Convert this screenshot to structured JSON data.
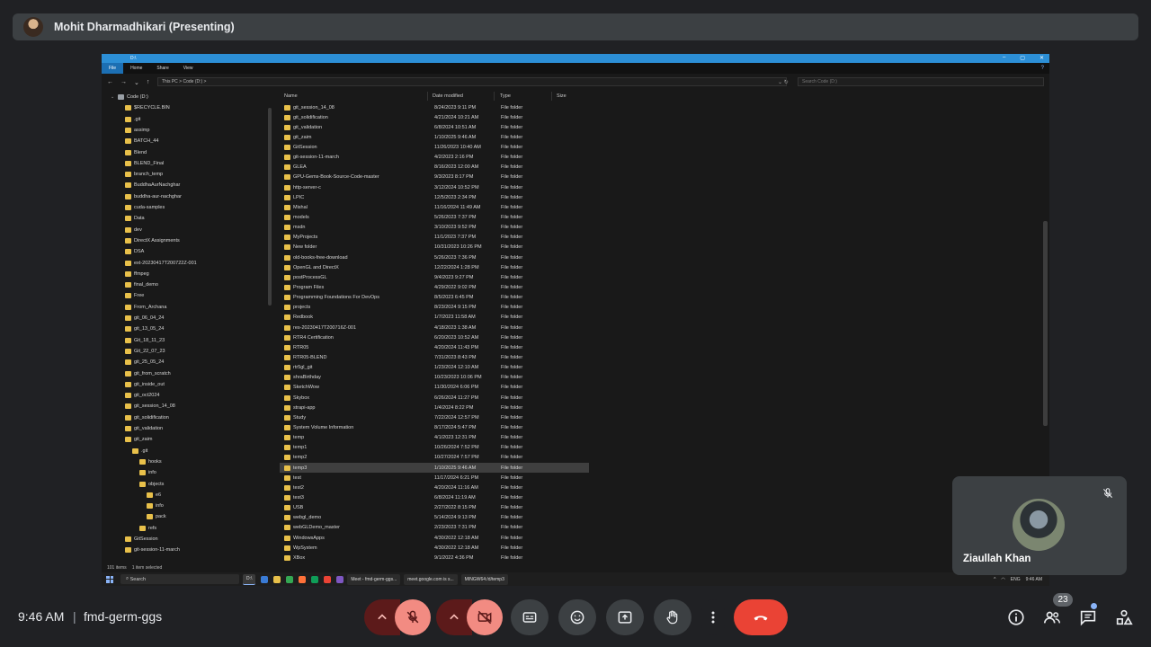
{
  "presenter": {
    "name": "Mohit Dharmadhikari (Presenting)"
  },
  "explorer": {
    "window_title": "D:\\",
    "ribbon_tabs": [
      "File",
      "Home",
      "Share",
      "View"
    ],
    "address": "This PC  >  Code (D:)  >",
    "search_placeholder": "Search Code (D:)",
    "columns": {
      "name": "Name",
      "date": "Date modified",
      "type": "Type",
      "size": "Size"
    },
    "nav_items": [
      {
        "label": "Code (D:)",
        "level": 0,
        "drive": true
      },
      {
        "label": "$RECYCLE.BIN",
        "level": 1
      },
      {
        "label": ".git",
        "level": 1
      },
      {
        "label": "assimp",
        "level": 1
      },
      {
        "label": "BATCH_44",
        "level": 1
      },
      {
        "label": "Blend",
        "level": 1
      },
      {
        "label": "BLEND_Final",
        "level": 1
      },
      {
        "label": "branch_temp",
        "level": 1
      },
      {
        "label": "BuddhaAurNachghar",
        "level": 1
      },
      {
        "label": "buddha-aur-nachghar",
        "level": 1
      },
      {
        "label": "cuda-samples",
        "level": 1
      },
      {
        "label": "Data",
        "level": 1
      },
      {
        "label": "dev",
        "level": 1
      },
      {
        "label": "DirectX Assignments",
        "level": 1
      },
      {
        "label": "DSA",
        "level": 1
      },
      {
        "label": "ext-20230417T200722Z-001",
        "level": 1
      },
      {
        "label": "ffmpeg",
        "level": 1
      },
      {
        "label": "final_demo",
        "level": 1
      },
      {
        "label": "Free",
        "level": 1
      },
      {
        "label": "From_Archana",
        "level": 1
      },
      {
        "label": "git_06_04_24",
        "level": 1
      },
      {
        "label": "git_13_05_24",
        "level": 1
      },
      {
        "label": "Git_18_11_23",
        "level": 1
      },
      {
        "label": "Git_22_07_23",
        "level": 1
      },
      {
        "label": "git_25_05_24",
        "level": 1
      },
      {
        "label": "git_from_scratch",
        "level": 1
      },
      {
        "label": "git_inside_out",
        "level": 1
      },
      {
        "label": "git_oct2024",
        "level": 1
      },
      {
        "label": "git_session_14_08",
        "level": 1
      },
      {
        "label": "git_solidification",
        "level": 1
      },
      {
        "label": "git_validation",
        "level": 1
      },
      {
        "label": "git_zaim",
        "level": 1
      },
      {
        "label": ".git",
        "level": 2
      },
      {
        "label": "hooks",
        "level": 3
      },
      {
        "label": "info",
        "level": 3
      },
      {
        "label": "objects",
        "level": 3
      },
      {
        "label": "e6",
        "level": 4
      },
      {
        "label": "info",
        "level": 4
      },
      {
        "label": "pack",
        "level": 4
      },
      {
        "label": "refs",
        "level": 3
      },
      {
        "label": "GitSession",
        "level": 1
      },
      {
        "label": "git-session-11-march",
        "level": 1
      }
    ],
    "files": [
      {
        "name": "git_session_14_08",
        "date": "8/24/2023 9:11 PM",
        "type": "File folder"
      },
      {
        "name": "git_solidification",
        "date": "4/21/2024 10:21 AM",
        "type": "File folder"
      },
      {
        "name": "git_validation",
        "date": "6/8/2024 10:51 AM",
        "type": "File folder"
      },
      {
        "name": "git_zaim",
        "date": "1/10/2025 9:46 AM",
        "type": "File folder"
      },
      {
        "name": "GitSession",
        "date": "11/26/2023 10:40 AM",
        "type": "File folder"
      },
      {
        "name": "git-session-11-march",
        "date": "4/2/2023 2:16 PM",
        "type": "File folder"
      },
      {
        "name": "GLEA",
        "date": "8/16/2023 12:00 AM",
        "type": "File folder"
      },
      {
        "name": "GPU-Gems-Book-Source-Code-master",
        "date": "9/3/2023 8:17 PM",
        "type": "File folder"
      },
      {
        "name": "http-server-c",
        "date": "3/12/2024 10:52 PM",
        "type": "File folder"
      },
      {
        "name": "LPIC",
        "date": "12/5/2023 2:34 PM",
        "type": "File folder"
      },
      {
        "name": "Mishal",
        "date": "11/16/2024 11:49 AM",
        "type": "File folder"
      },
      {
        "name": "models",
        "date": "5/26/2023 7:37 PM",
        "type": "File folder"
      },
      {
        "name": "msdn",
        "date": "3/10/2023 9:52 PM",
        "type": "File folder"
      },
      {
        "name": "MyProjects",
        "date": "11/1/2023 7:37 PM",
        "type": "File folder"
      },
      {
        "name": "New folder",
        "date": "10/31/2023 10:26 PM",
        "type": "File folder"
      },
      {
        "name": "old-books-free-download",
        "date": "5/26/2023 7:36 PM",
        "type": "File folder"
      },
      {
        "name": "OpenGL and DirectX",
        "date": "12/22/2024 1:28 PM",
        "type": "File folder"
      },
      {
        "name": "postProcessGL",
        "date": "9/4/2023 9:27 PM",
        "type": "File folder"
      },
      {
        "name": "Program Files",
        "date": "4/29/2022 9:02 PM",
        "type": "File folder"
      },
      {
        "name": "Programming Foundations For DevOps",
        "date": "8/5/2023 6:45 PM",
        "type": "File folder"
      },
      {
        "name": "projects",
        "date": "8/23/2024 9:15 PM",
        "type": "File folder"
      },
      {
        "name": "Redbook",
        "date": "1/7/2023 11:58 AM",
        "type": "File folder"
      },
      {
        "name": "res-20230417T200716Z-001",
        "date": "4/18/2023 1:38 AM",
        "type": "File folder"
      },
      {
        "name": "RTR4 Certification",
        "date": "6/20/2023 10:52 AM",
        "type": "File folder"
      },
      {
        "name": "RTR05",
        "date": "4/20/2024 11:43 PM",
        "type": "File folder"
      },
      {
        "name": "RTR05-BLEND",
        "date": "7/31/2023 8:43 PM",
        "type": "File folder"
      },
      {
        "name": "rtr5gl_git",
        "date": "1/23/2024 12:10 AM",
        "type": "File folder"
      },
      {
        "name": "shraBirthday",
        "date": "10/23/2023 10:06 PM",
        "type": "File folder"
      },
      {
        "name": "SketchWow",
        "date": "11/30/2024 6:06 PM",
        "type": "File folder"
      },
      {
        "name": "Skybox",
        "date": "6/26/2024 11:27 PM",
        "type": "File folder"
      },
      {
        "name": "strapi-app",
        "date": "1/4/2024 8:22 PM",
        "type": "File folder"
      },
      {
        "name": "Study",
        "date": "7/22/2024 12:57 PM",
        "type": "File folder"
      },
      {
        "name": "System Volume Information",
        "date": "8/17/2024 5:47 PM",
        "type": "File folder"
      },
      {
        "name": "temp",
        "date": "4/1/2023 12:31 PM",
        "type": "File folder"
      },
      {
        "name": "temp1",
        "date": "10/26/2024 7:52 PM",
        "type": "File folder"
      },
      {
        "name": "temp2",
        "date": "10/27/2024 7:57 PM",
        "type": "File folder"
      },
      {
        "name": "temp3",
        "date": "1/10/2025 9:46 AM",
        "type": "File folder",
        "selected": true
      },
      {
        "name": "test",
        "date": "11/17/2024 6:21 PM",
        "type": "File folder"
      },
      {
        "name": "test2",
        "date": "4/20/2024 11:16 AM",
        "type": "File folder"
      },
      {
        "name": "test3",
        "date": "6/8/2024 11:19 AM",
        "type": "File folder"
      },
      {
        "name": "USB",
        "date": "2/27/2022 8:15 PM",
        "type": "File folder"
      },
      {
        "name": "webgl_demo",
        "date": "5/14/2024 9:13 PM",
        "type": "File folder"
      },
      {
        "name": "webGLDemo_master",
        "date": "2/23/2023 7:31 PM",
        "type": "File folder"
      },
      {
        "name": "WindowsApps",
        "date": "4/30/2022 12:18 AM",
        "type": "File folder"
      },
      {
        "name": "WpSystem",
        "date": "4/30/2022 12:18 AM",
        "type": "File folder"
      },
      {
        "name": "XBox",
        "date": "9/1/2022 4:36 PM",
        "type": "File folder"
      }
    ],
    "status": {
      "items": "101 items",
      "selected": "1 item selected"
    },
    "taskbar": {
      "search": "Search",
      "apps": [
        "D:\\",
        "Meet - fmd-germ-ggs...",
        "meet.google.com is s...",
        "MINGW64:/d/temp3"
      ],
      "tray_lang": "ENG",
      "tray_time": "9:46 AM"
    }
  },
  "participant": {
    "name": "Ziaullah Khan"
  },
  "meeting": {
    "time": "9:46 AM",
    "divider": "|",
    "code": "fmd-germ-ggs",
    "participant_count": "23"
  }
}
